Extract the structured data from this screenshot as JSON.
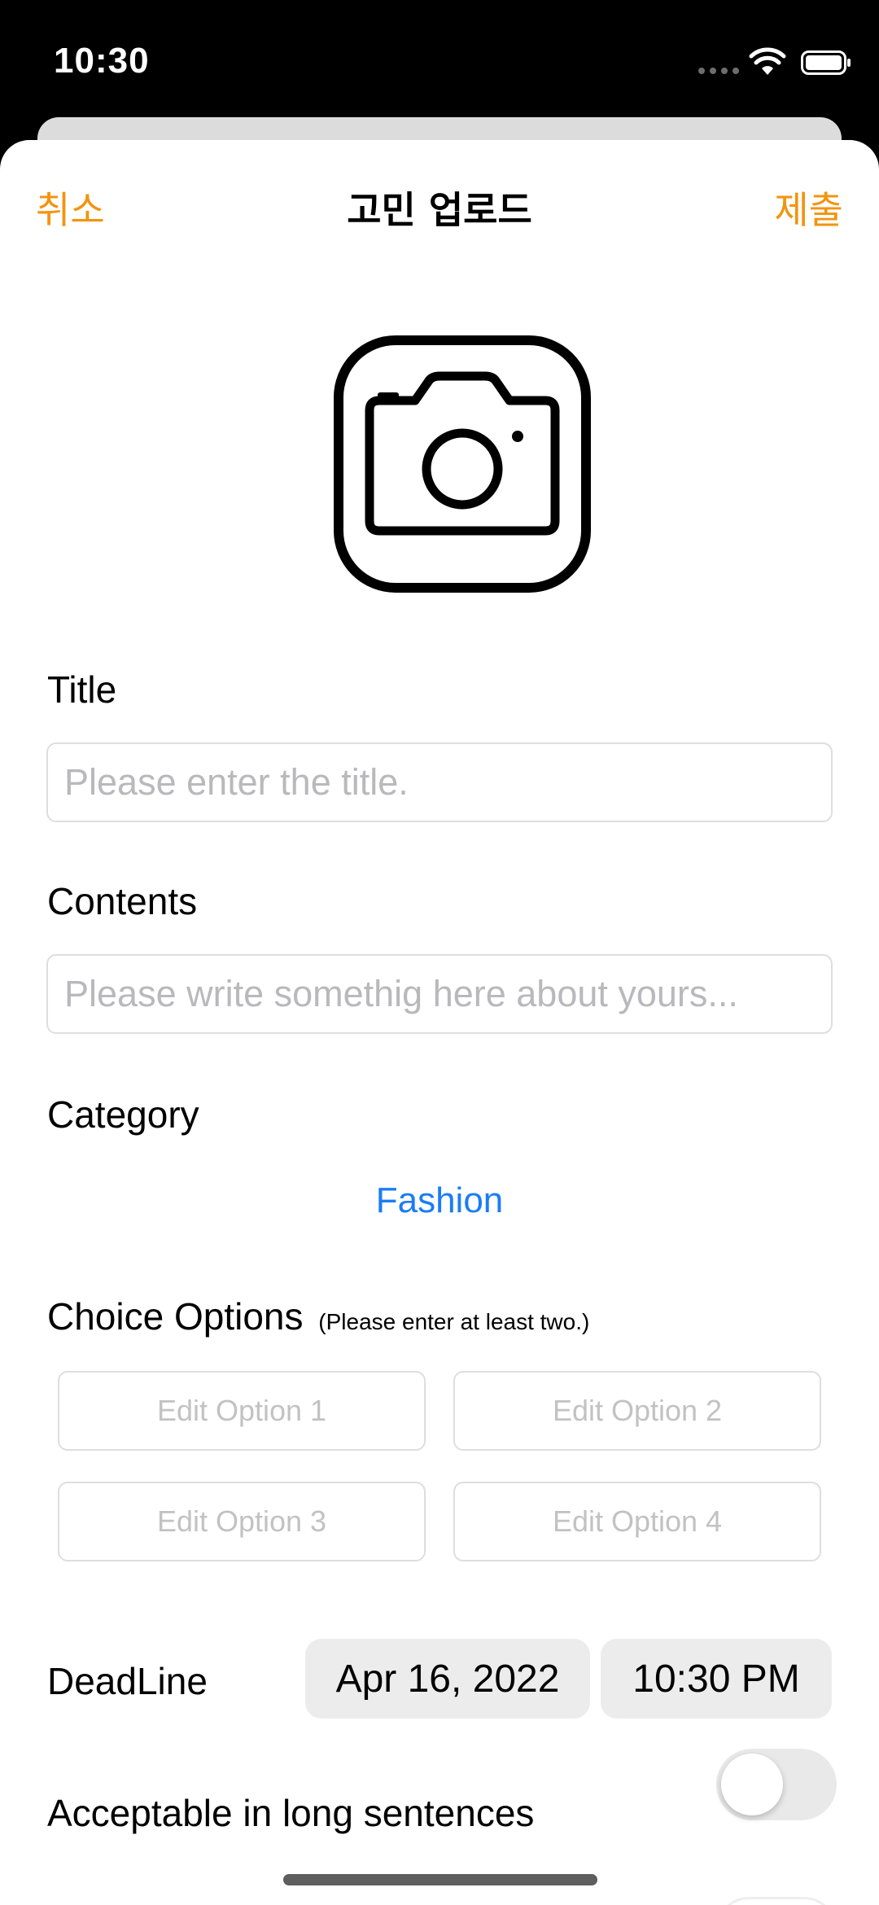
{
  "status_bar": {
    "time": "10:30"
  },
  "nav": {
    "cancel_label": "취소",
    "title": "고민 업로드",
    "submit_label": "제출"
  },
  "form": {
    "title_label": "Title",
    "title_placeholder": "Please enter the title.",
    "contents_label": "Contents",
    "contents_placeholder": "Please write somethig here about yours...",
    "category_label": "Category",
    "category_value": "Fashion",
    "choice_label": "Choice Options",
    "choice_hint": "(Please enter at least two.)",
    "options": [
      "Edit Option 1",
      "Edit Option 2",
      "Edit Option 3",
      "Edit Option 4"
    ],
    "deadline_label": "DeadLine",
    "deadline_date": "Apr 16, 2022",
    "deadline_time": "10:30 PM",
    "long_sentences_label": "Acceptable in long sentences",
    "long_sentences_enabled": false
  },
  "colors": {
    "accent": "#f2940f",
    "link": "#1b7cf5",
    "placeholder": "#b9b9bd"
  },
  "icons": {
    "photo_picker": "camera-icon"
  }
}
